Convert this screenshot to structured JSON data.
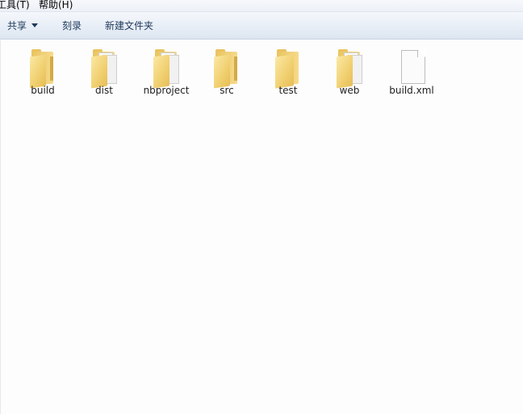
{
  "menu": {
    "tools": "工具(T)",
    "help": "帮助(H)"
  },
  "toolbar": {
    "share": "共享",
    "burn": "刻录",
    "new_folder": "新建文件夹"
  },
  "files": [
    {
      "name": "build",
      "type": "folder",
      "icon": "folder-icon"
    },
    {
      "name": "dist",
      "type": "folder",
      "icon": "folder-icon"
    },
    {
      "name": "nbproject",
      "type": "folder",
      "icon": "folder-icon"
    },
    {
      "name": "src",
      "type": "folder",
      "icon": "folder-icon"
    },
    {
      "name": "test",
      "type": "folder",
      "icon": "folder-icon"
    },
    {
      "name": "web",
      "type": "folder",
      "icon": "folder-icon"
    },
    {
      "name": "build.xml",
      "type": "file",
      "icon": "file-icon"
    }
  ],
  "colors": {
    "toolbar_top": "#f5f8fc",
    "toolbar_bottom": "#dde6f1",
    "toolbar_text": "#1e395b",
    "folder": "#f0cf6f"
  }
}
